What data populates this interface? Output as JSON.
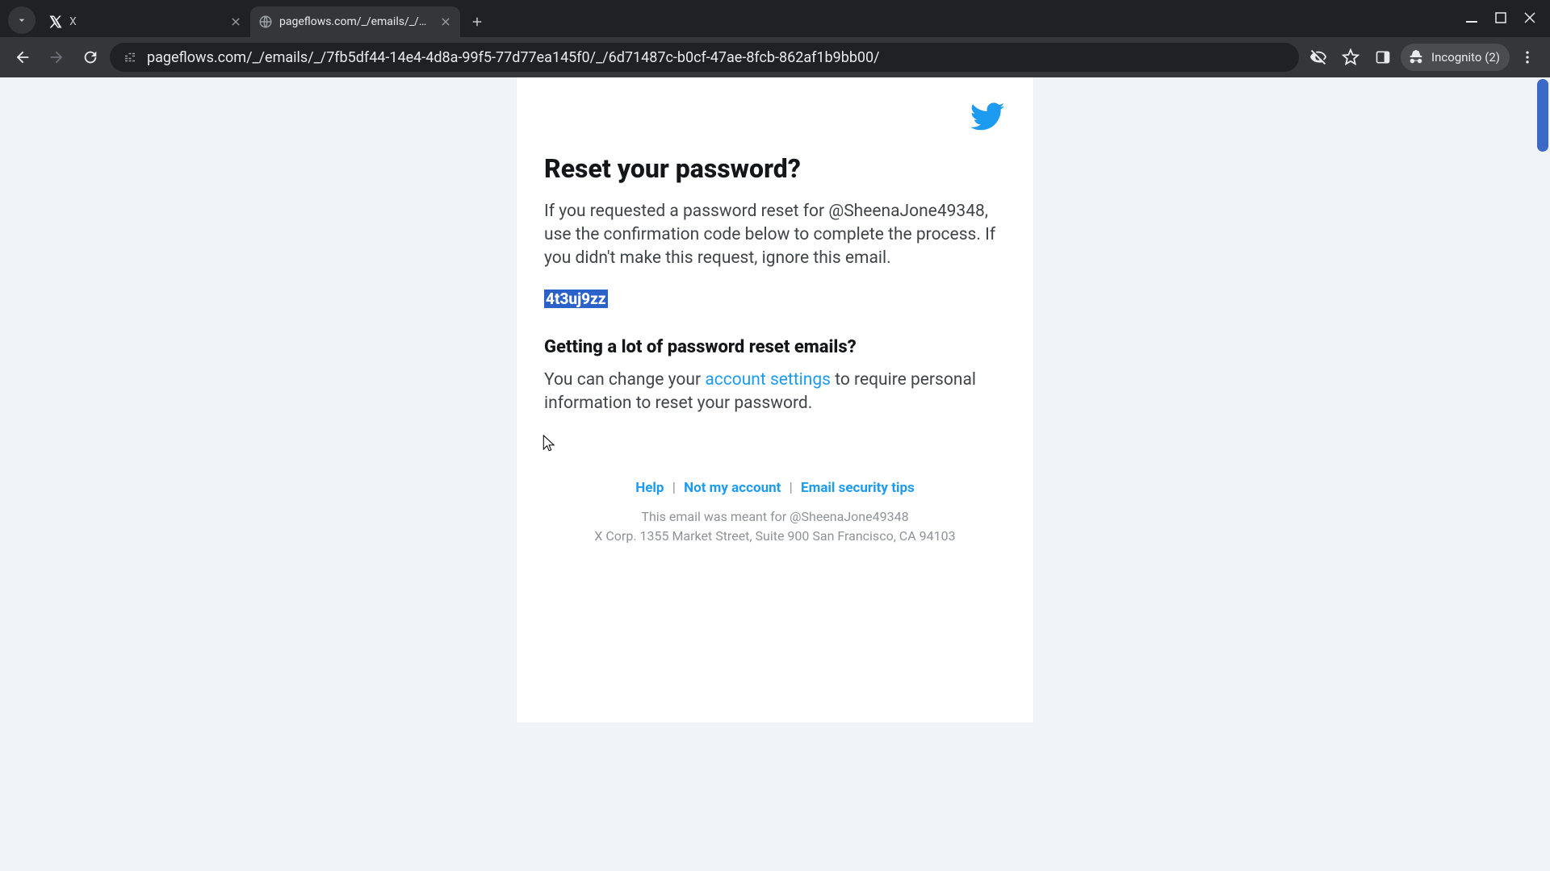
{
  "browser": {
    "tabs": [
      {
        "title": "X",
        "active": false
      },
      {
        "title": "pageflows.com/_/emails/_/7fb5",
        "active": true
      }
    ],
    "url": "pageflows.com/_/emails/_/7fb5df44-14e4-4d8a-99f5-77d77ea145f0/_/6d71487c-b0cf-47ae-8fcb-862af1b9bb00/",
    "incognito_label": "Incognito (2)"
  },
  "email": {
    "heading": "Reset your password?",
    "body": "If you requested a password reset for @SheenaJone49348, use the confirmation code below to complete the process. If you didn't make this request, ignore this email.",
    "code": "4t3uj9zz",
    "sub_heading": "Getting a lot of password reset emails?",
    "settings_pre": "You can change your ",
    "settings_link": "account settings",
    "settings_post": " to require personal information to reset your password.",
    "footer": {
      "links": {
        "help": "Help",
        "not_my_account": "Not my account",
        "security": "Email security tips"
      },
      "sep": "|",
      "meant_for": "This email was meant for @SheenaJone49348",
      "address": "X Corp. 1355 Market Street, Suite 900 San Francisco, CA 94103"
    }
  }
}
